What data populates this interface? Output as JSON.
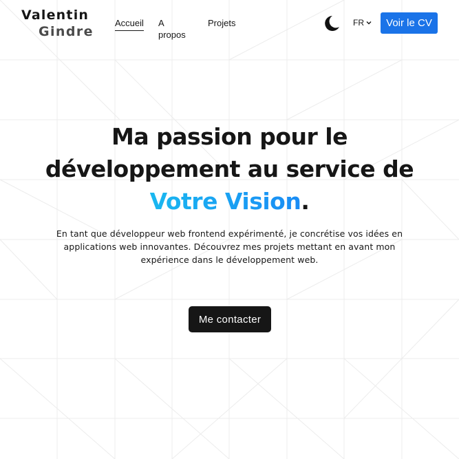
{
  "header": {
    "logo_first": "Valentin",
    "logo_last": "Gindre",
    "nav": [
      {
        "label": "Accueil"
      },
      {
        "label": "A propos"
      },
      {
        "label": "Projets"
      }
    ],
    "theme_icon": "moon-icon",
    "language": "FR",
    "cv_button": "Voir le CV"
  },
  "hero": {
    "title_line1": "Ma passion pour le",
    "title_line2": "développement au service de",
    "title_highlight": "Votre Vision",
    "title_end": ".",
    "description": "En tant que développeur web frontend expérimenté, je concrétise vos idées en applications web innovantes. Découvrez mes projets mettant en avant mon expérience dans le développement web.",
    "contact_button": "Me contacter"
  },
  "colors": {
    "accent": "#1a73e8",
    "gradient_start": "#1ab8f0",
    "gradient_end": "#1a8cf5",
    "dark": "#161616"
  }
}
